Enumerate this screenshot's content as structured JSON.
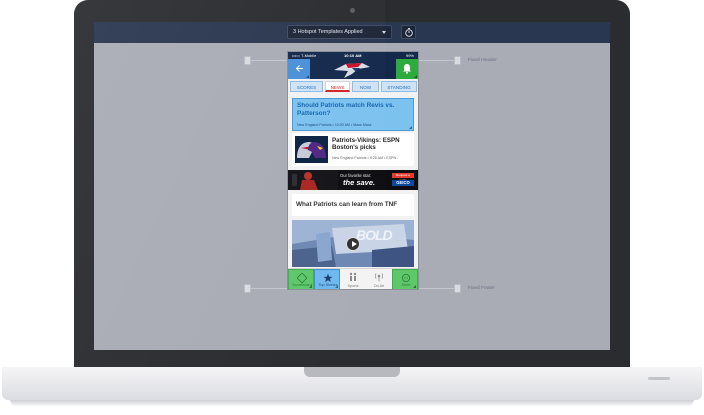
{
  "toolbar": {
    "template_select_value": "3 Hotspot Templates Applied",
    "timer_icon": "stopwatch-icon"
  },
  "guides": {
    "fixed_header_label": "Fixed Header",
    "fixed_footer_label": "Fixed Footer"
  },
  "phone": {
    "status": {
      "carrier": "••••○ T-Mobile",
      "time": "10:10 AM",
      "battery": "99%"
    },
    "header": {
      "back_icon": "arrow-left-icon",
      "logo_icon": "patriots-logo-icon",
      "bell_icon": "bell-icon"
    },
    "tabs": [
      {
        "label": "SCORES",
        "active": false
      },
      {
        "label": "NEWS",
        "active": true
      },
      {
        "label": "NOW",
        "active": false
      },
      {
        "label": "STANDING",
        "active": false
      }
    ],
    "headline_card": {
      "title": "Should Patriots match Revis vs. Patterson?",
      "meta": "New England Patriots • 10:00 AM • Mass Mass"
    },
    "story_card": {
      "title": "Patriots-Vikings: ESPN Boston's picks",
      "meta": "New England Patriots • 9:26 AM • ESPN..."
    },
    "ad": {
      "tagline": "Our favorite stat:",
      "headline": "the save.",
      "cta": "Request a quote",
      "brand": "GEICO"
    },
    "text_card": {
      "title": "What Patriots can learn from TNF"
    },
    "video": {
      "caption_art": "BOLD"
    },
    "tabbar": [
      {
        "label": "Scoreboard",
        "icon": "scoreboard-icon",
        "hotspot": "green"
      },
      {
        "label": "Top Stories",
        "icon": "star-icon",
        "hotspot": "blue"
      },
      {
        "label": "Sports",
        "icon": "sports-icon",
        "hotspot": "none"
      },
      {
        "label": "On Air",
        "icon": "on-air-icon",
        "hotspot": "none"
      },
      {
        "label": "More",
        "icon": "more-icon",
        "hotspot": "green"
      }
    ]
  },
  "colors": {
    "screen_bg": "#a9abb5",
    "toolbar_bg": "#2a3750",
    "hotspot_green": "#5ec76a",
    "hotspot_blue": "#6fb8ee",
    "team_navy": "#13284b",
    "news_red": "#d2232a"
  }
}
